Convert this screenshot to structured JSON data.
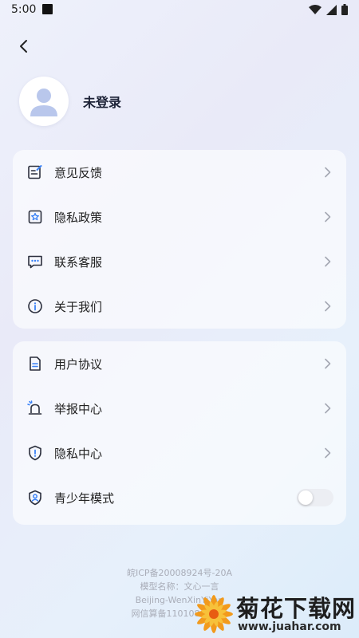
{
  "status_bar": {
    "time": "5:00"
  },
  "profile": {
    "login_text": "未登录"
  },
  "group1": [
    {
      "label": "意见反馈",
      "icon": "feedback-edit-icon"
    },
    {
      "label": "隐私政策",
      "icon": "privacy-policy-badge-icon"
    },
    {
      "label": "联系客服",
      "icon": "chat-dots-icon"
    },
    {
      "label": "关于我们",
      "icon": "info-icon"
    }
  ],
  "group2": [
    {
      "label": "用户协议",
      "icon": "document-icon"
    },
    {
      "label": "举报中心",
      "icon": "alarm-bell-icon"
    },
    {
      "label": "隐私中心",
      "icon": "shield-alert-icon"
    },
    {
      "label": "青少年模式",
      "icon": "shield-user-icon",
      "toggle_on": false
    }
  ],
  "footer": {
    "line1": "皖ICP备20008924号-20A",
    "line2": "模型名称：文心一言",
    "line3": "Beijing-WenXinYiYan",
    "line4": "网信算备11010864550"
  },
  "watermark": {
    "title": "菊花下载网",
    "url": "www.juahar.com"
  },
  "colors": {
    "icon_stroke": "#2b2f3d",
    "icon_accent": "#3b82f6",
    "avatar_fill": "#b9c7ec"
  }
}
